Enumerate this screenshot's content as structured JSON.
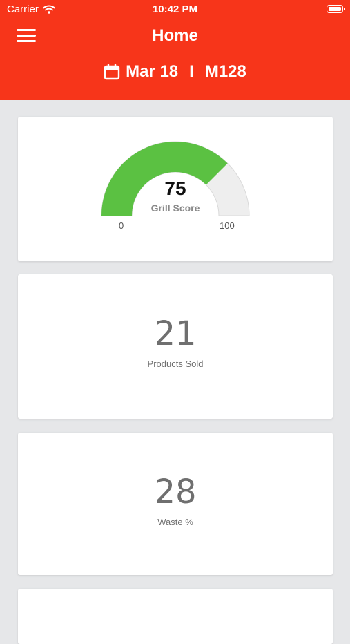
{
  "status_bar": {
    "carrier": "Carrier",
    "time": "10:42 PM"
  },
  "header": {
    "title": "Home",
    "date": "Mar 18",
    "separator": "I",
    "store": "M128",
    "color": "#f7351a"
  },
  "grill_score": {
    "value": "75",
    "label": "Grill Score",
    "min": "0",
    "max": "100",
    "level": 0.75,
    "fill_color": "#5bc142",
    "track_color": "#eeeeee"
  },
  "products_sold": {
    "value": "21",
    "label": "Products Sold"
  },
  "waste": {
    "value": "28",
    "label": "Waste %"
  }
}
